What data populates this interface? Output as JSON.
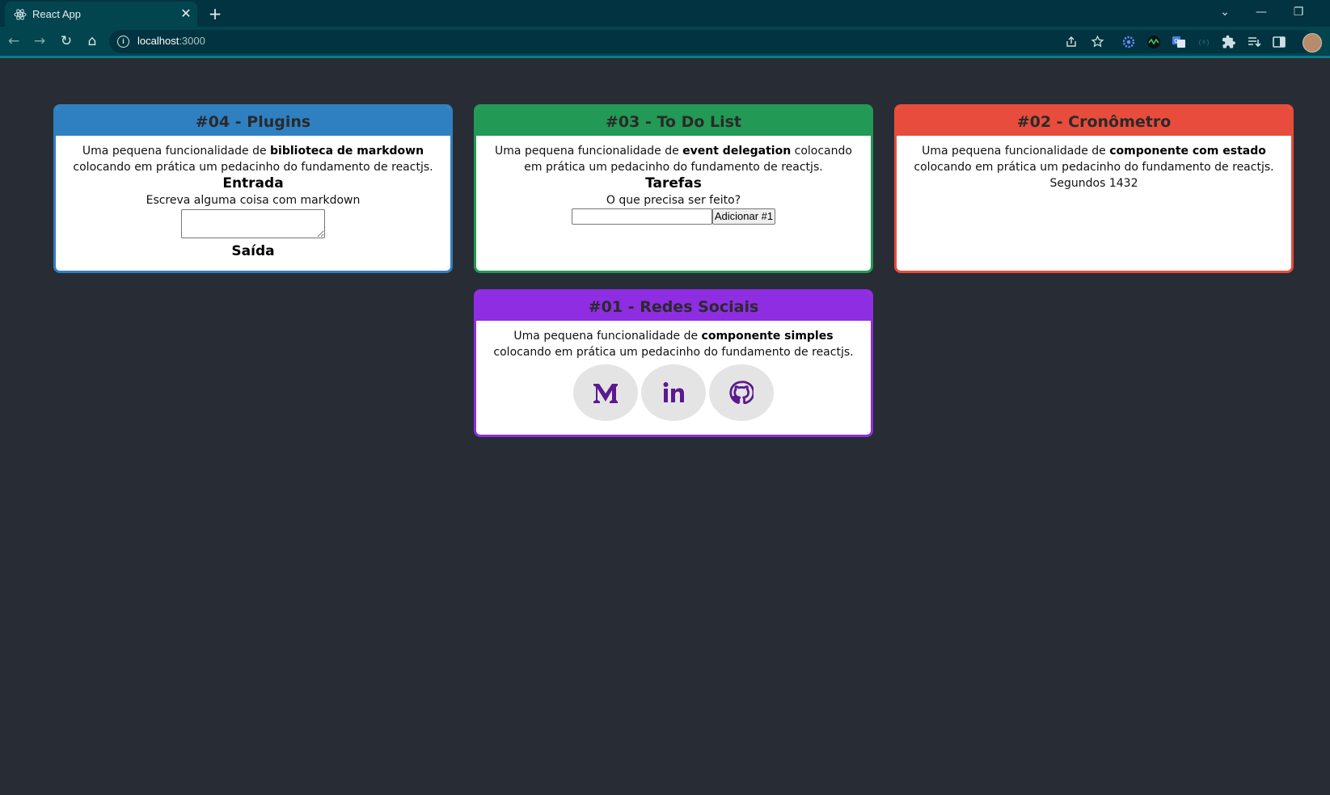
{
  "browser": {
    "tab_title": "React App",
    "tab_close": "✕",
    "new_tab": "+",
    "url_host": "localhost",
    "url_port": ":3000",
    "window_controls": [
      "⌄",
      "—",
      "❐"
    ],
    "nav": {
      "back": "←",
      "forward": "→",
      "reload": "↻",
      "home": "⌂"
    }
  },
  "cards": {
    "plugins": {
      "title": "#04 - Plugins",
      "color": "#2f80c1",
      "desc_pre": "Uma pequena funcionalidade de ",
      "desc_bold": "biblioteca de markdown",
      "desc_post": " colocando em prática um pedacinho do fundamento de reactjs.",
      "input_heading": "Entrada",
      "input_label": "Escreva alguma coisa com markdown",
      "input_value": "",
      "output_heading": "Saída"
    },
    "todo": {
      "title": "#03 - To Do List",
      "color": "#229954",
      "desc_pre": "Uma pequena funcionalidade de ",
      "desc_bold": "event delegation",
      "desc_post": " colocando em prática um pedacinho do fundamento de reactjs.",
      "heading": "Tarefas",
      "label": "O que precisa ser feito?",
      "input_value": "",
      "button": "Adicionar #1"
    },
    "timer": {
      "title": "#02 - Cronômetro",
      "color": "#e74c3c",
      "desc_pre": "Uma pequena funcionalidade de ",
      "desc_bold": "componente com estado",
      "desc_post": " colocando em prática um pedacinho do fundamento de reactjs.",
      "seconds": "Segundos 1432"
    },
    "social": {
      "title": "#01 - Redes Sociais",
      "color": "#8e2de2",
      "desc_pre": "Uma pequena funcionalidade de ",
      "desc_bold": "componente simples",
      "desc_post": " colocando em prática um pedacinho do fundamento de reactjs.",
      "icons": [
        "medium-icon",
        "linkedin-icon",
        "github-icon"
      ],
      "icon_color": "#5b1a8f"
    }
  }
}
